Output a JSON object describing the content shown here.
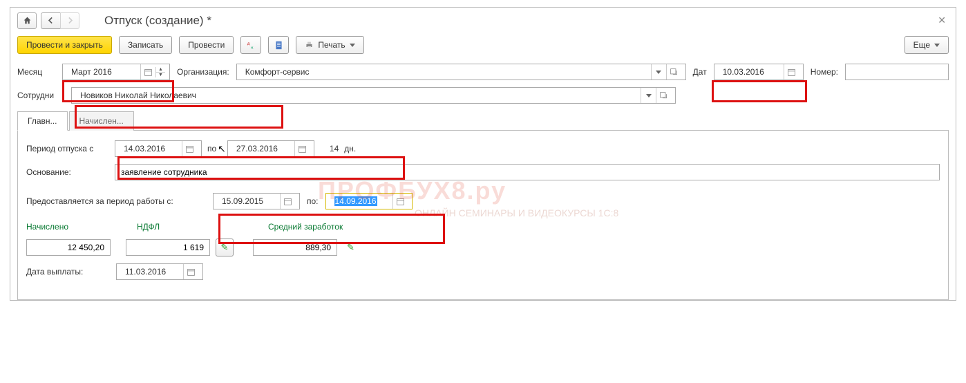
{
  "header": {
    "title": "Отпуск (создание) *"
  },
  "toolbar": {
    "post_close": "Провести и закрыть",
    "save": "Записать",
    "post": "Провести",
    "print": "Печать",
    "more": "Еще"
  },
  "form": {
    "month_label": "Месяц",
    "month_value": "Март 2016",
    "org_label": "Организация:",
    "org_value": "Комфорт-сервис",
    "date_label": "Дат",
    "date_value": "10.03.2016",
    "number_label": "Номер:",
    "number_value": "",
    "employee_label": "Сотрудни",
    "employee_value": "Новиков Николай Николаевич"
  },
  "tabs": {
    "main": "Главн...",
    "accrued": "Начислен..."
  },
  "period": {
    "label": "Период отпуска с",
    "from": "14.03.2016",
    "to_label": "по",
    "to": "27.03.2016",
    "days": "14",
    "days_unit": "дн."
  },
  "basis": {
    "label": "Основание:",
    "value": "заявление сотрудника"
  },
  "work_period": {
    "label": "Предоставляется за период работы с:",
    "from": "15.09.2015",
    "to_label": "по:",
    "to": "14.09.2016"
  },
  "summary": {
    "accrued_label": "Начислено",
    "accrued_value": "12 450,20",
    "ndfl_label": "НДФЛ",
    "ndfl_value": "1 619",
    "avg_label": "Средний заработок",
    "avg_value": "889,30"
  },
  "payout": {
    "label": "Дата выплаты:",
    "value": "11.03.2016"
  },
  "watermark": {
    "main": "ПРОФБУХ8.ру",
    "sub": "ОНЛАЙН СЕМИНАРЫ И ВИДЕОКУРСЫ 1С:8"
  }
}
